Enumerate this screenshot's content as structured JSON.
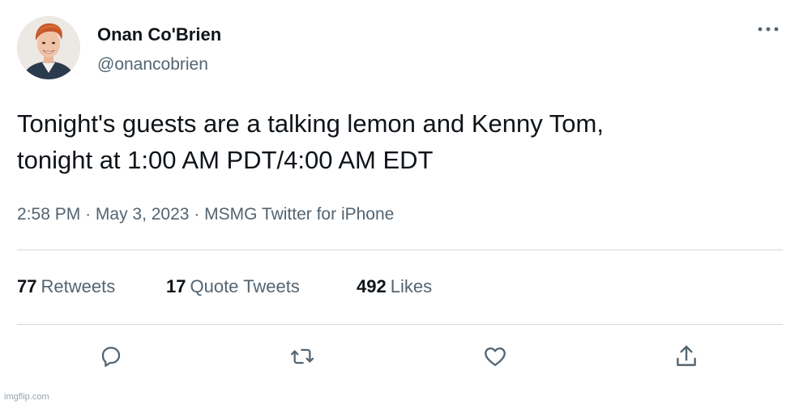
{
  "author": {
    "display_name": "Onan Co'Brien",
    "handle": "@onancobrien"
  },
  "tweet": {
    "text_lines": [
      "Tonight's guests are a talking lemon and Kenny Tom,",
      "tonight at 1:00 AM PDT/4:00 AM EDT"
    ],
    "time": "2:58 PM",
    "separator": "·",
    "date": "May 3, 2023",
    "source": "MSMG Twitter for iPhone"
  },
  "stats": {
    "retweets": {
      "count": "77",
      "label": "Retweets"
    },
    "quote_tweets": {
      "count": "17",
      "label": "Quote Tweets"
    },
    "likes": {
      "count": "492",
      "label": "Likes"
    }
  },
  "icons": {
    "more": "more-horizontal-icon",
    "reply": "reply-icon",
    "retweet": "retweet-icon",
    "like": "heart-icon",
    "share": "share-icon"
  },
  "watermark": "imgflip.com",
  "colors": {
    "text_primary": "#0f1419",
    "text_secondary": "#536471",
    "divider": "#cfd9de"
  }
}
